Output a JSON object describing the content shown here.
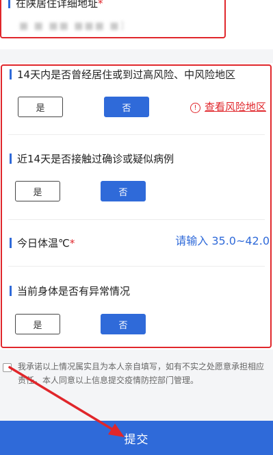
{
  "address": {
    "label": "在陕居住详细地址",
    "required_mark": "*",
    "value": "■ ■ ■■ ■■■ ■]"
  },
  "questions": {
    "risk_area": {
      "label": "14天内是否曾经居住或到过高风险、中风险地区",
      "yes": "是",
      "no": "否",
      "link_icon": "!",
      "link_text": "查看风险地区"
    },
    "contact": {
      "label": "近14天是否接触过确诊或疑似病例",
      "yes": "是",
      "no": "否"
    },
    "temperature": {
      "label": "今日体温℃",
      "required_mark": "*",
      "placeholder": "请输入 35.0~42.0"
    },
    "abnormal": {
      "label": "当前身体是否有异常情况",
      "yes": "是",
      "no": "否"
    }
  },
  "promise": {
    "text": "我承诺以上情况属实且为本人亲自填写，如有不实之处愿意承担相应责任。本人同意以上信息提交疫情防控部门管理。"
  },
  "submit": {
    "label": "提交"
  },
  "colors": {
    "accent": "#2f6ad9",
    "annotation_red": "#e0262b",
    "background": "#f4f5f7"
  }
}
